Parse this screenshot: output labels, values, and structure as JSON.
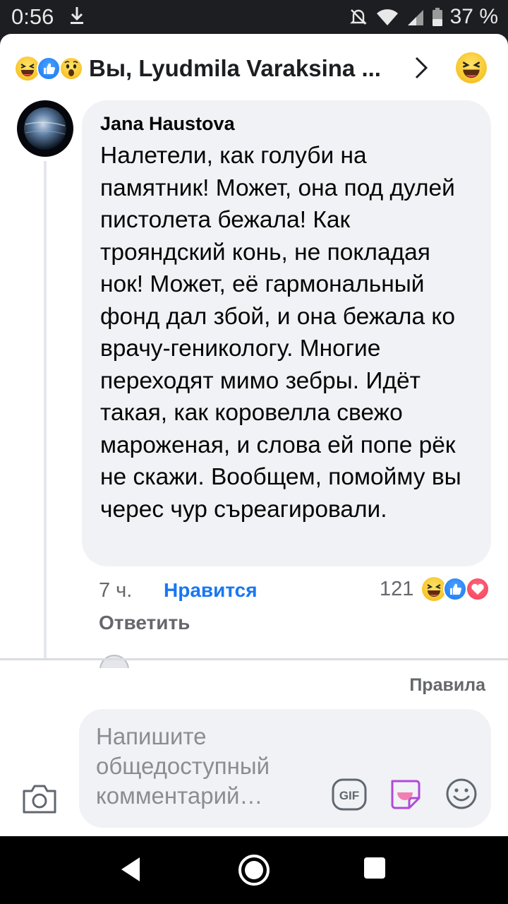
{
  "status_bar": {
    "time": "0:56",
    "battery": "37 %",
    "download_icon": "download-arrow-icon",
    "icons": [
      "mute-icon",
      "wifi-icon",
      "signal-icon",
      "battery-icon"
    ]
  },
  "header": {
    "reactions": [
      "haha-emoji",
      "like-emoji",
      "wow-emoji"
    ],
    "title": "Вы, Lyudmila Varaksina ...",
    "chevron": "chevron-right-icon",
    "reaction_button": "haha-emoji"
  },
  "comment": {
    "author": "Jana Haustova",
    "text": "Налетели, как голуби на памятник! Может, она под дулей пистолета бежала! Как трояндский конь, не покладая нок! Может, её гармональный фонд дал збой, и она бежала ко врачу-геникологу. Многие переходят мимо зебры. Идёт такая, как коровелла свежо мароженая, и слова ей попе рёк не скажи. Вообщем, помойму вы черес чур съреагировали.",
    "time": "7 ч.",
    "like_label": "Нравится",
    "reaction_count": "121",
    "reactions": [
      "haha-emoji",
      "like-emoji",
      "love-emoji"
    ],
    "reply_label": "Ответить"
  },
  "composer": {
    "rules_label": "Правила",
    "placeholder": "Напишите общедоступный комментарий…",
    "gif_label": "GIF",
    "icons": [
      "camera-icon",
      "gif-icon",
      "sticker-icon",
      "smiley-icon"
    ]
  },
  "colors": {
    "accent": "#1877f2",
    "secondary_text": "#65676b",
    "bubble": "#f0f2f5",
    "status_bar": "#1c1e21"
  },
  "nav_bar": {
    "icons": [
      "back-icon",
      "home-icon",
      "recents-icon"
    ]
  }
}
